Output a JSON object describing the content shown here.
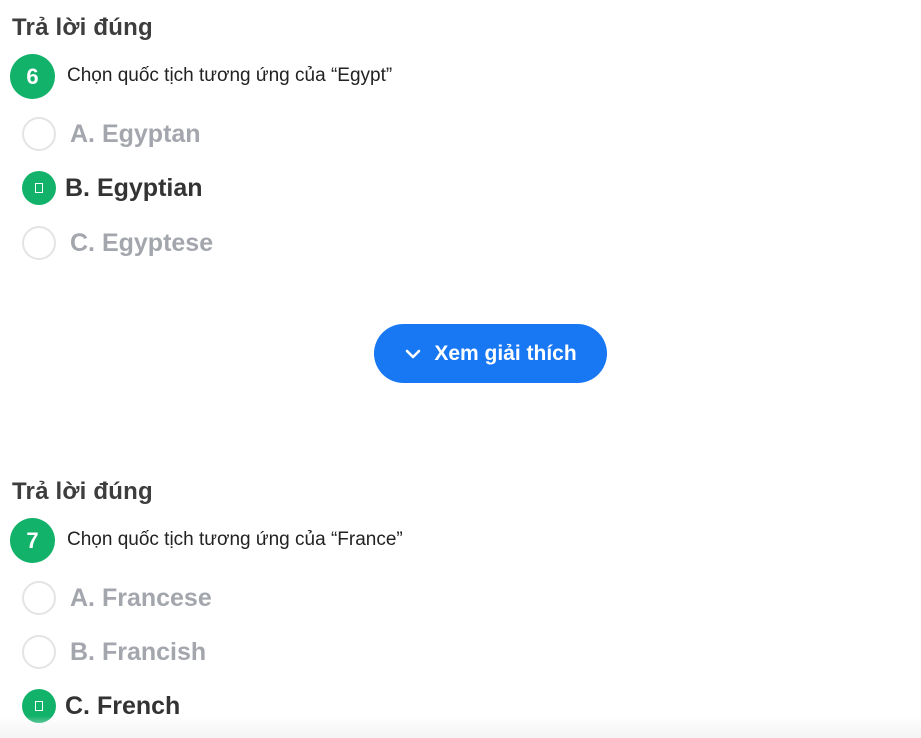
{
  "questions": [
    {
      "status": "Trả lời đúng",
      "number": "6",
      "text": "Chọn quốc tịch tương ứng của “Egypt”",
      "options": [
        {
          "label": "A. Egyptan",
          "selected": false
        },
        {
          "label": "B. Egyptian",
          "selected": true
        },
        {
          "label": "C. Egyptese",
          "selected": false
        }
      ],
      "explain_button": "Xem giải thích"
    },
    {
      "status": "Trả lời đúng",
      "number": "7",
      "text": "Chọn quốc tịch tương ứng của “France”",
      "options": [
        {
          "label": "A. Francese",
          "selected": false
        },
        {
          "label": "B. Francish",
          "selected": false
        },
        {
          "label": "C. French",
          "selected": true
        }
      ]
    }
  ],
  "colors": {
    "correct_green": "#13b26b",
    "button_blue": "#1877f2",
    "unselected_text": "#a3a6ad"
  },
  "icons": {
    "explain_button_icon": "chevron-down-icon"
  }
}
